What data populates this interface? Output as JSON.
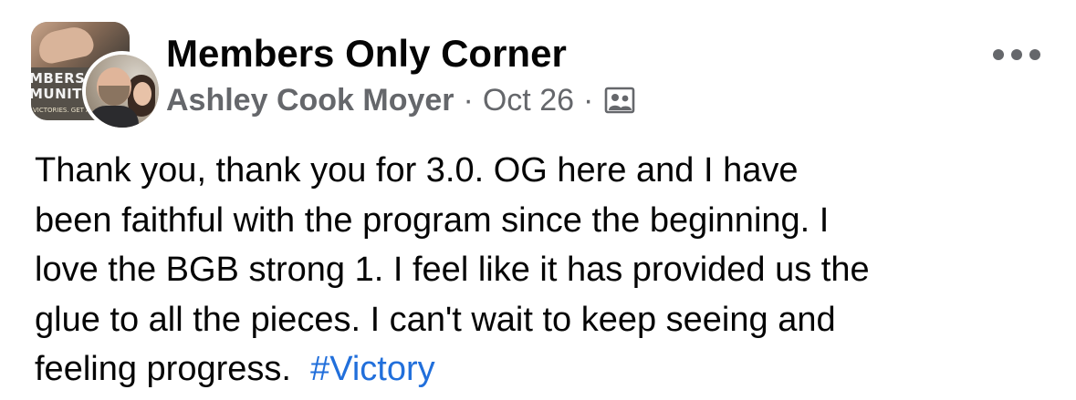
{
  "header": {
    "group_name": "Members Only Corner",
    "author": "Ashley Cook Moyer",
    "separator": "·",
    "date": "Oct 26",
    "audience_icon": "group-audience-icon",
    "more_icon": "more-options-icon"
  },
  "group_avatar": {
    "banner_text": "MBERS\nMUNIT",
    "tagline": "VICTORIES. GET A"
  },
  "post": {
    "lines": [
      "Thank you, thank you for 3.0. OG here and I have",
      "been faithful with the program since the beginning. I",
      "love the BGB strong 1. I feel like it has provided us the",
      "glue to all the pieces. I can't wait to keep seeing and"
    ],
    "last_line_text": "feeling progress.",
    "hashtag": "#Victory"
  },
  "colors": {
    "text_primary": "#050505",
    "text_secondary": "#65676b",
    "hashtag": "#216fdb",
    "background": "#ffffff"
  }
}
